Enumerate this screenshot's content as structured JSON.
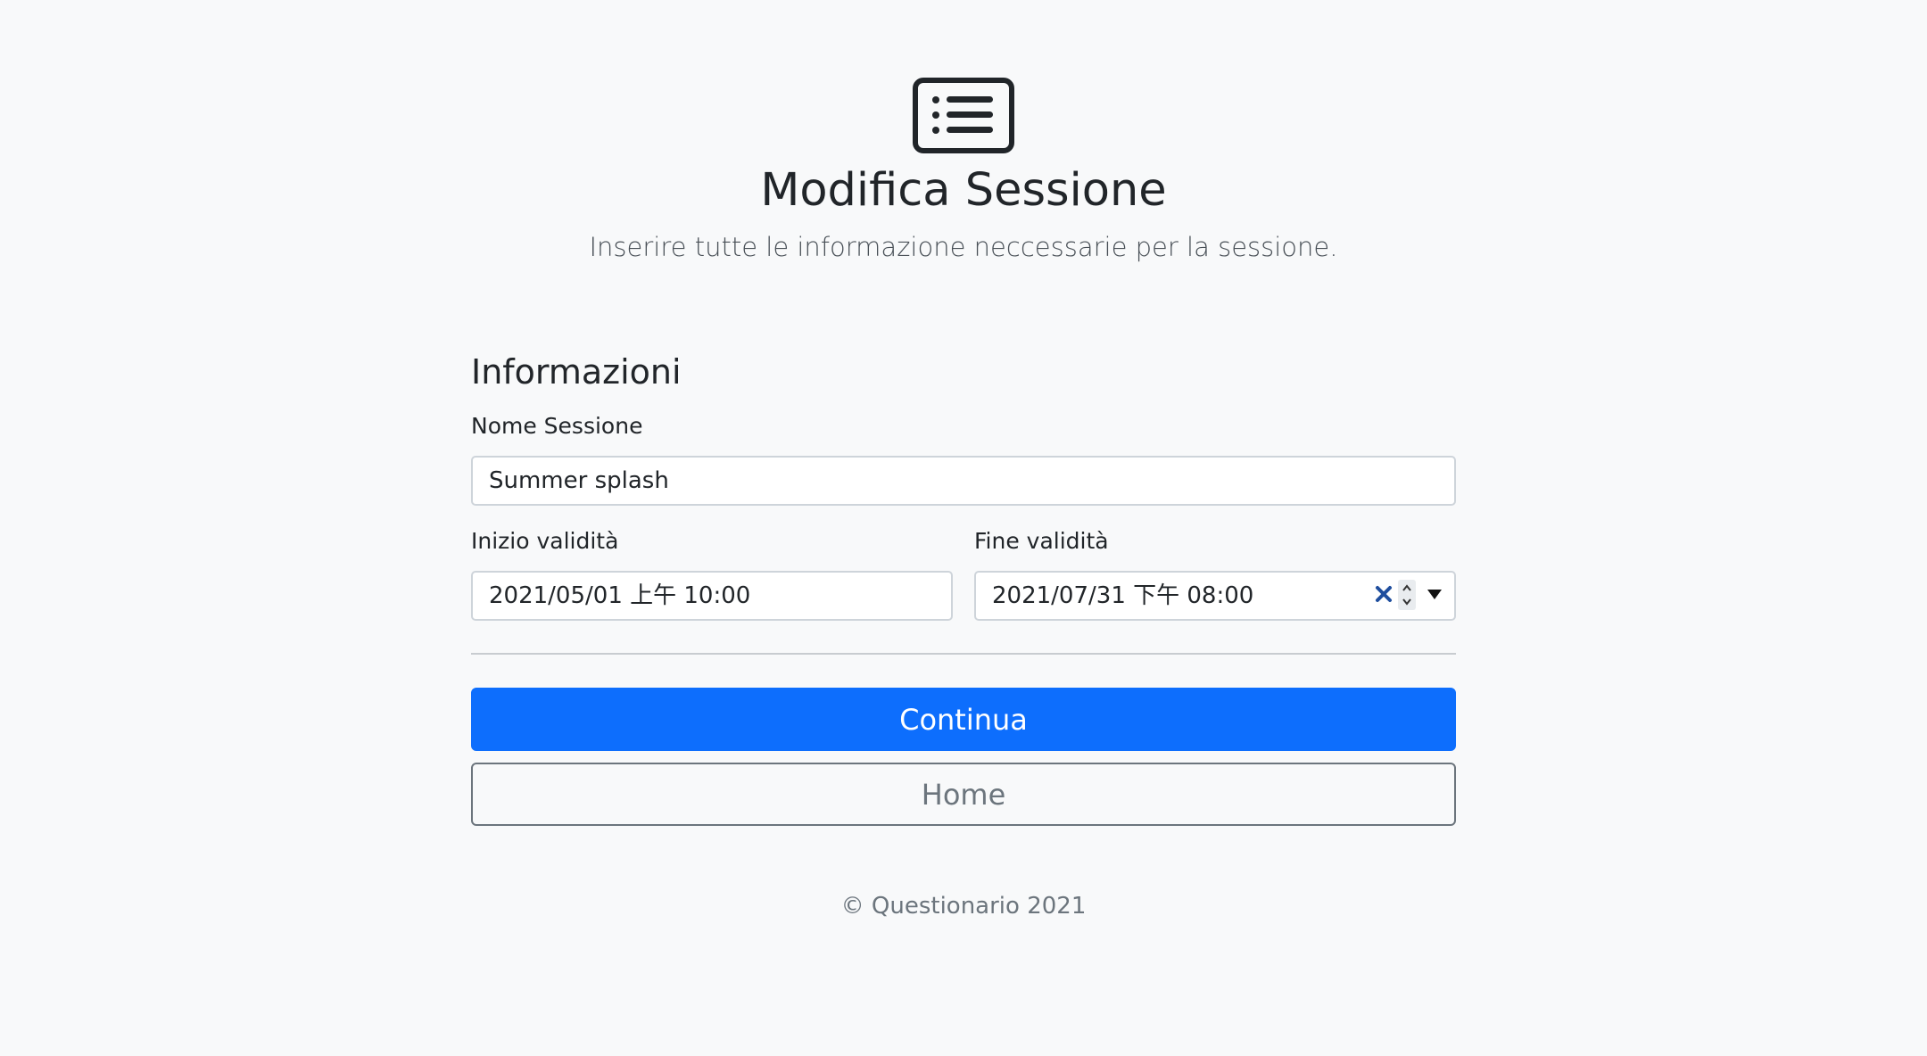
{
  "header": {
    "logo_icon": "list-card-icon",
    "title": "Modifica Sessione",
    "subtitle": "Inserire tutte le informazione neccessarie per la sessione."
  },
  "form": {
    "section_title": "Informazioni",
    "session_name": {
      "label": "Nome Sessione",
      "value": "Summer splash"
    },
    "start_validity": {
      "label": "Inizio validità",
      "value": "2021/05/01 上午 10:00"
    },
    "end_validity": {
      "label": "Fine validità",
      "value": "2021/07/31 下午 08:00",
      "clear_icon": "close-icon",
      "spin_icon": "spinner-icon",
      "dropdown_icon": "caret-down-icon"
    },
    "continue_label": "Continua",
    "home_label": "Home"
  },
  "footer": {
    "text": "© Questionario 2021"
  },
  "colors": {
    "background": "#f8f9fa",
    "primary": "#0d6efd",
    "secondary": "#6c757d",
    "text": "#212529"
  }
}
